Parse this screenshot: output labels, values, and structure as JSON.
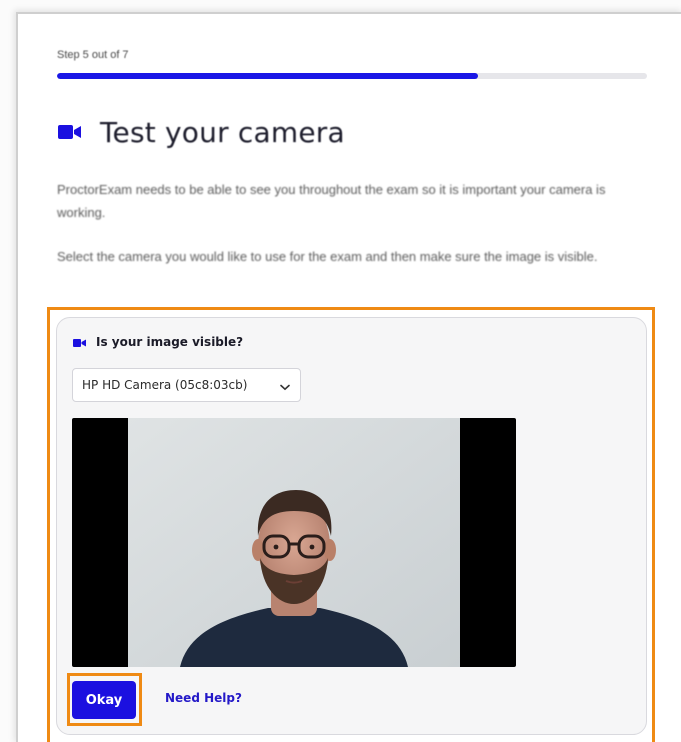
{
  "step": {
    "label": "Step 5 out of 7",
    "current": 5,
    "total": 7,
    "progress_fraction": 0.714
  },
  "heading": {
    "title": "Test your camera",
    "icon": "video-camera-icon"
  },
  "intro": {
    "paragraph_1": "ProctorExam needs to be able to see you throughout the exam so it is important your camera is working.",
    "paragraph_2": "Select the camera you would like to use for the exam and then make sure the image is visible."
  },
  "camera_check": {
    "title": "Is your image visible?",
    "icon": "video-camera-icon",
    "selected_camera": "HP HD Camera (05c8:03cb)",
    "dropdown_icon": "chevron-down-icon"
  },
  "actions": {
    "okay_label": "Okay",
    "help_label": "Need Help?"
  },
  "colors": {
    "accent": "#1b10e0",
    "highlight": "#ef8a14",
    "link": "#2419c8"
  }
}
